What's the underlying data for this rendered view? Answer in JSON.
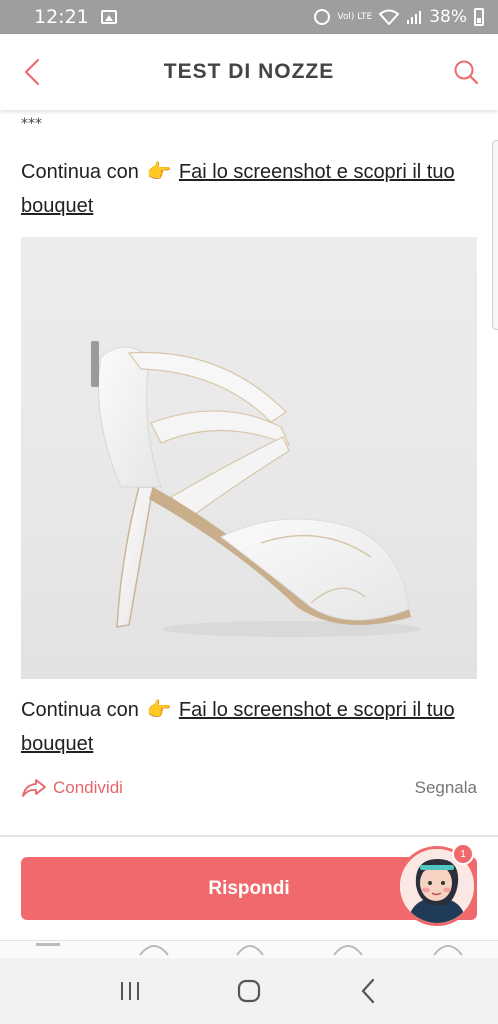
{
  "status_bar": {
    "time": "12:21",
    "volte_label": "Vol) LTE",
    "battery": "38%"
  },
  "header": {
    "title": "TEST DI NOZZE"
  },
  "post": {
    "stars": "***",
    "cta_prefix": "Continua con",
    "cta_emoji": "👉",
    "cta_link": "Fai lo screenshot e scopri il tuo bouquet",
    "share_label": "Condividi",
    "report_label": "Segnala"
  },
  "reply": {
    "button_label": "Rispondi",
    "badge_count": "1"
  },
  "colors": {
    "accent": "#f0696c",
    "status_bar": "#9e9e9e"
  }
}
